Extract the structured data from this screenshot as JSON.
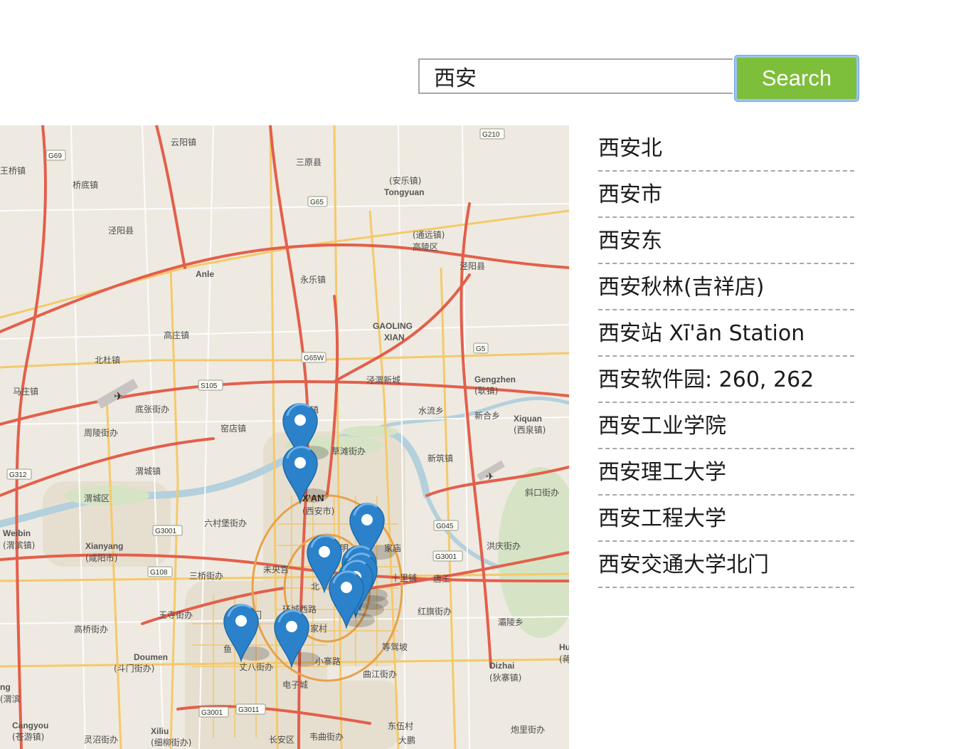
{
  "search": {
    "query": "西安",
    "button_label": "Search"
  },
  "map": {
    "place_labels": [
      "云阳镇",
      "三原县",
      "王桥镇",
      "桥底镇",
      "泾阳县",
      "Anle",
      "(安乐镇)",
      "Tongyuan",
      "(通远镇)",
      "高陵区",
      "泾阳县",
      "永乐镇",
      "GAOLING",
      "XIAN",
      "高庄镇",
      "北杜镇",
      "泾渭新城",
      "Gengzhen",
      "(耿镇)",
      "马庄镇",
      "底张街办",
      "正阳镇",
      "水流乡",
      "新合乡",
      "Xiquan",
      "(西泉镇)",
      "周陵街办",
      "窑店镇",
      "草滩街办",
      "新筑镇",
      "渭城镇",
      "渭城区",
      "X'AN",
      "(西安市)",
      "斜口街办",
      "六村堡街办",
      "Weibin",
      "(渭滨镇)",
      "Xianyang",
      "(咸阳市)",
      "明",
      "家庙",
      "洪庆街办",
      "未央宫",
      "十里铺",
      "三桥街办",
      "北",
      "唐王",
      "王寺街办",
      "环城西路",
      "红旗街办",
      "门",
      "灞陵乡",
      "高桥街办",
      "家村",
      "等驾坡",
      "Doumen",
      "(斗门街办)",
      "鱼",
      "丈八街办",
      "小寨路",
      "曲江街办",
      "Dizhai",
      "(狄寨镇)",
      "电子城",
      "Cangyou",
      "(苍游镇)",
      "灵沼街办",
      "Xiliu",
      "(细柳街办)",
      "长安区",
      "韦曲街办",
      "东伍村",
      "大鹏",
      "炮里街办",
      "Hu",
      "(蒋",
      "ng",
      "(渭滨"
    ],
    "road_shields": [
      "G69",
      "G210",
      "G65",
      "G65W",
      "G5",
      "S105",
      "G312",
      "G3001",
      "G3001",
      "G045",
      "G108",
      "G3001",
      "G3011"
    ],
    "marker_count": 10
  },
  "results": [
    "西安北",
    "西安市",
    "西安东",
    "西安秋林(吉祥店)",
    "西安站 Xī'ān Station",
    "西安软件园: 260, 262",
    "西安工业学院",
    "西安理工大学",
    "西安工程大学",
    "西安交通大学北门"
  ]
}
